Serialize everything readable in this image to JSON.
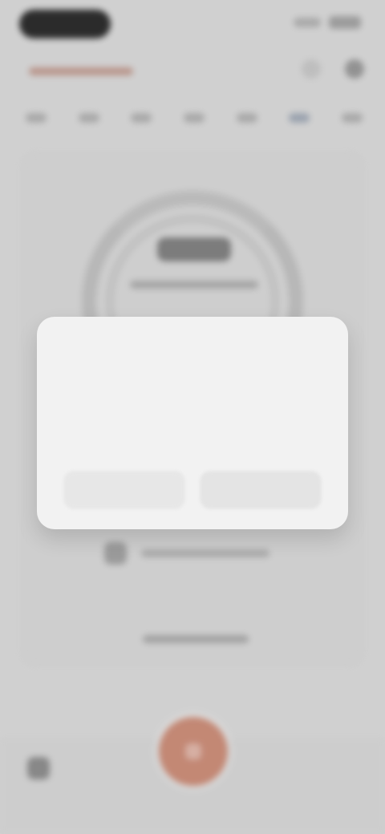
{
  "modal": {
    "title": "",
    "body": "",
    "buttons": {
      "secondary": "",
      "primary": ""
    }
  }
}
